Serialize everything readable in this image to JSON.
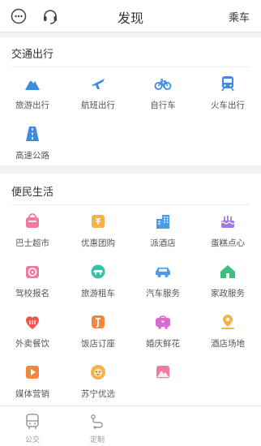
{
  "header": {
    "title": "发现",
    "right_label": "乘车",
    "left_icons": [
      "chat-bubble-icon",
      "headset-icon"
    ]
  },
  "sections": [
    {
      "title": "交通出行",
      "items": [
        {
          "label": "旅游出行",
          "icon": "mountain-icon",
          "color": "#3d8be0"
        },
        {
          "label": "航班出行",
          "icon": "airplane-icon",
          "color": "#3d8be0"
        },
        {
          "label": "自行车",
          "icon": "bicycle-icon",
          "color": "#3d8be0"
        },
        {
          "label": "火车出行",
          "icon": "train-icon",
          "color": "#3d8be0"
        },
        {
          "label": "高速公路",
          "icon": "highway-icon",
          "color": "#3d8be0"
        }
      ]
    },
    {
      "title": "便民生活",
      "items": [
        {
          "label": "巴士超市",
          "icon": "shop-basket-icon",
          "color": "#f07aa0"
        },
        {
          "label": "优惠团购",
          "icon": "coupon-icon",
          "color": "#f4b24a"
        },
        {
          "label": "派酒店",
          "icon": "hotel-building-icon",
          "color": "#4a9be8"
        },
        {
          "label": "蛋糕点心",
          "icon": "cake-icon",
          "color": "#a67ad8"
        },
        {
          "label": "驾校报名",
          "icon": "driving-school-icon",
          "color": "#f07aa0"
        },
        {
          "label": "旅游租车",
          "icon": "globe-car-icon",
          "color": "#3cbfa8"
        },
        {
          "label": "汽车服务",
          "icon": "car-icon",
          "color": "#4a9be8"
        },
        {
          "label": "家政服务",
          "icon": "house-icon",
          "color": "#3cbf7a"
        },
        {
          "label": "外卖餐饮",
          "icon": "food-delivery-icon",
          "color": "#f0564e"
        },
        {
          "label": "饭店订座",
          "icon": "restaurant-booking-icon",
          "color": "#f0873c"
        },
        {
          "label": "婚庆鲜花",
          "icon": "wedding-car-icon",
          "color": "#d86ad0"
        },
        {
          "label": "酒店场地",
          "icon": "venue-pin-icon",
          "color": "#f4b24a"
        },
        {
          "label": "媒体营销",
          "icon": "media-play-icon",
          "color": "#f0873c"
        },
        {
          "label": "苏宁优选",
          "icon": "lion-icon",
          "color": "#f4b24a"
        },
        {
          "label": "",
          "icon": "mountain-pink-icon",
          "color": "#f07aa0"
        }
      ]
    }
  ],
  "tabbar": [
    {
      "label": "公交",
      "icon": "bus-icon"
    },
    {
      "label": "定制",
      "icon": "route-icon"
    }
  ]
}
